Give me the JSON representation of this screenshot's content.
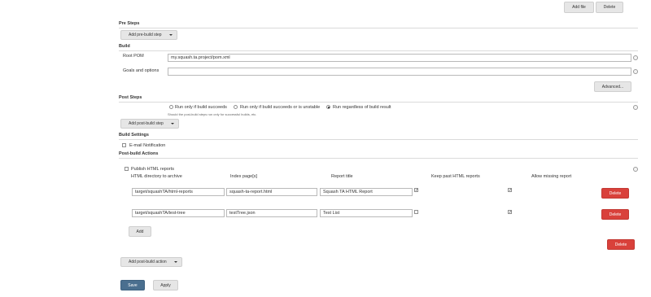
{
  "top_buttons": {
    "add_file": "Add file",
    "delete": "Delete"
  },
  "pre_steps": {
    "title": "Pre Steps",
    "add_button": "Add pre-build step"
  },
  "build": {
    "title": "Build",
    "root_pom_label": "Root POM",
    "root_pom_value": "my.squash.ta.project/pom.xml",
    "goals_label": "Goals and options",
    "goals_value": "",
    "advanced_button": "Advanced..."
  },
  "post_steps": {
    "title": "Post Steps",
    "options": [
      {
        "label": "Run only if build succeeds",
        "selected": false
      },
      {
        "label": "Run only if build succeeds or is unstable",
        "selected": false
      },
      {
        "label": "Run regardless of build result",
        "selected": true
      }
    ],
    "hint": "Should the post-build steps run only for successful builds, etc.",
    "add_button": "Add post-build step"
  },
  "build_settings": {
    "title": "Build Settings",
    "email_label": "E-mail Notification",
    "email_checked": false
  },
  "post_build_actions": {
    "title": "Post-build Actions",
    "publish_html": {
      "title": "Publish HTML reports",
      "checked": false,
      "headers": {
        "dir": "HTML directory to archive",
        "index": "Index page[s]",
        "title": "Report title",
        "keep": "Keep past HTML reports",
        "allow": "Allow missing report"
      },
      "rows": [
        {
          "dir": "target/squashTA/html-reports",
          "index": "squash-ta-report.html",
          "title": "Squash TA HTML Report",
          "keep": true,
          "allow": true,
          "delete": "Delete"
        },
        {
          "dir": "target/squashTA/test-tree",
          "index": "testTree.json",
          "title": "Test List",
          "keep": false,
          "allow": true,
          "delete": "Delete"
        }
      ],
      "add_button": "Add",
      "delete_button": "Delete"
    },
    "add_action_button": "Add post-build action"
  },
  "footer": {
    "save": "Save",
    "apply": "Apply"
  },
  "colors": {
    "danger": "#d9413b",
    "primary": "#4a6f8f",
    "button": "#e6e6e6"
  }
}
